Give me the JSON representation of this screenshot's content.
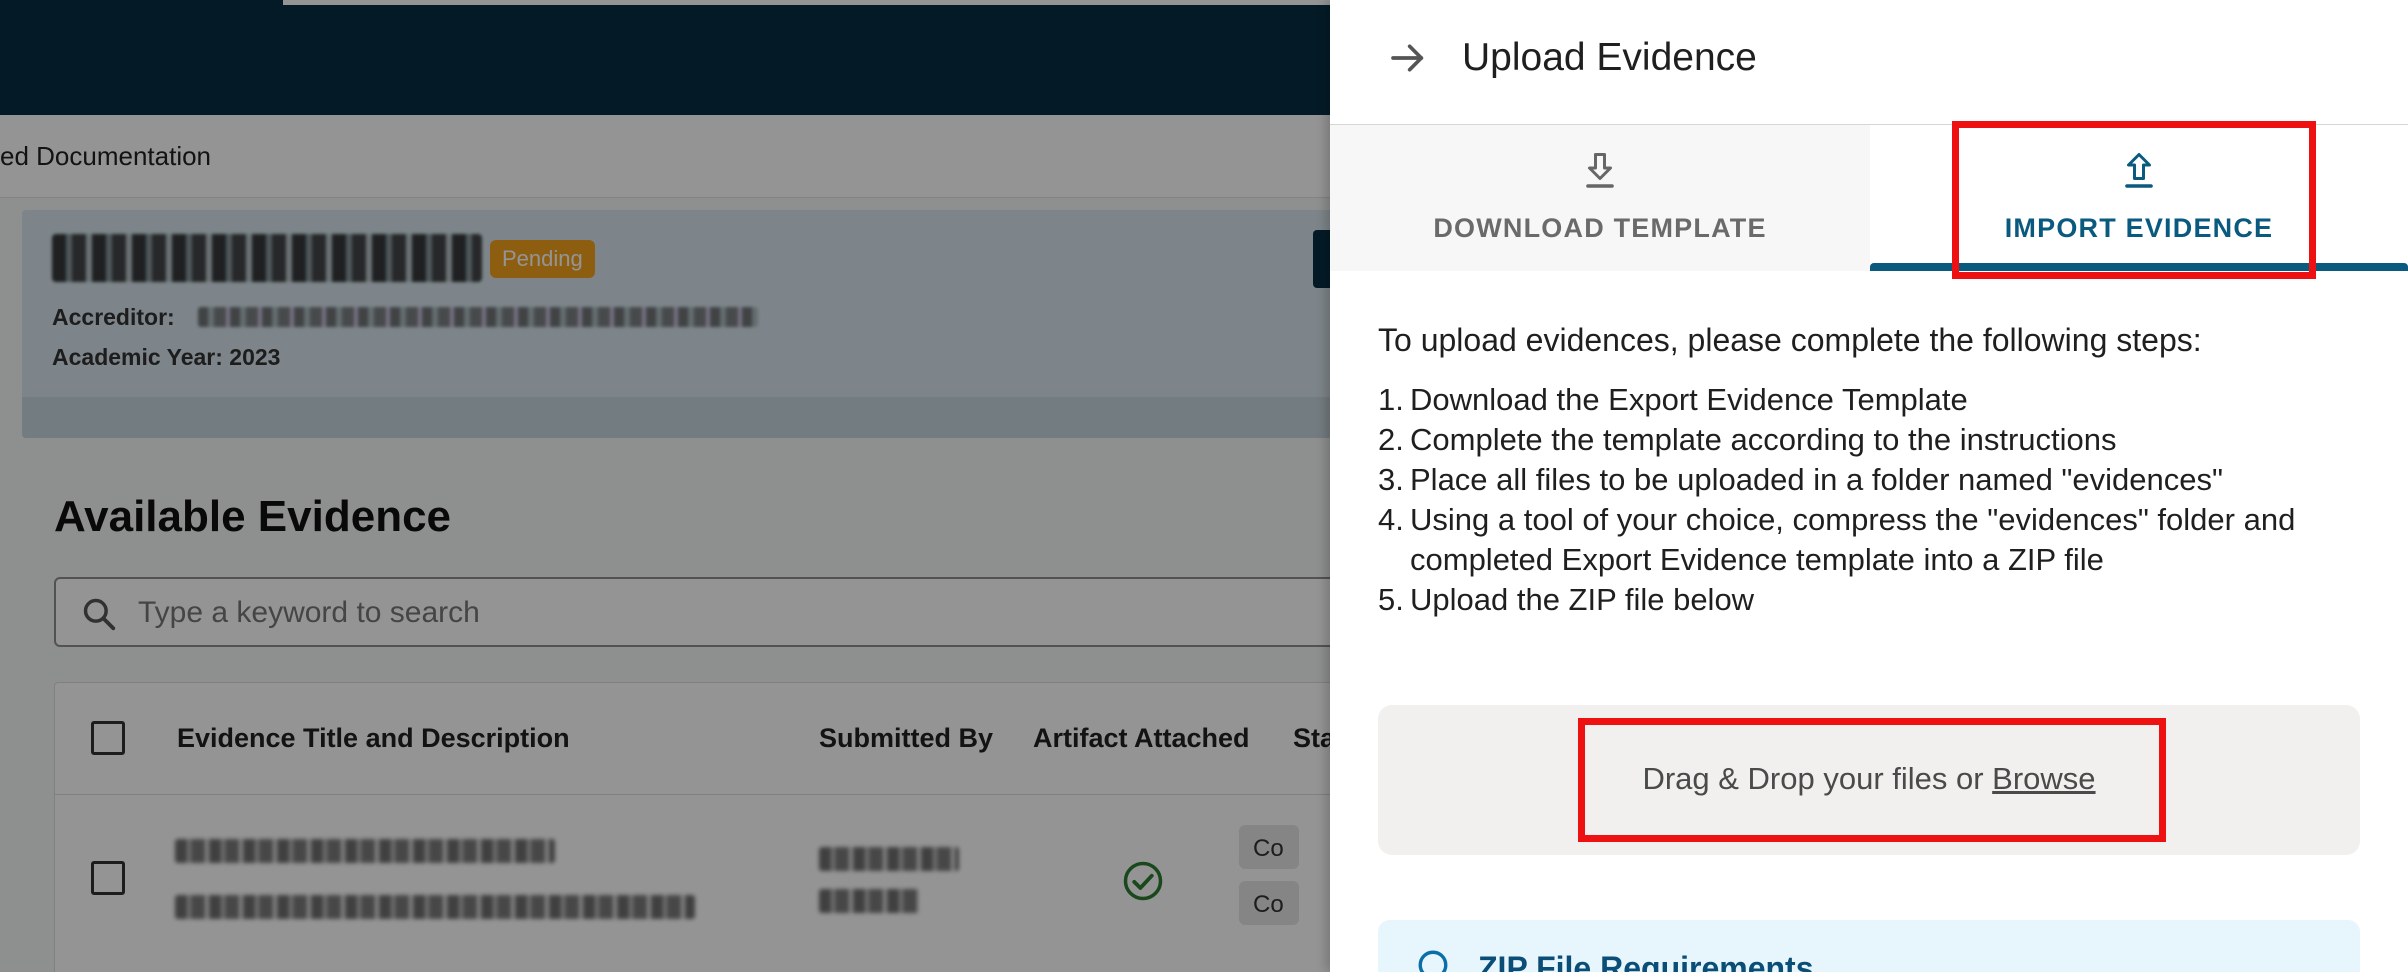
{
  "background": {
    "breadcrumb": "ed Documentation",
    "status_badge": "Pending",
    "accreditor_label": "Accreditor:",
    "academic_year": "Academic Year: 2023",
    "section_title": "Available Evidence",
    "search_placeholder": "Type a keyword to search",
    "columns": [
      "Evidence Title and Description",
      "Submitted By",
      "Artifact Attached",
      "Sta"
    ],
    "status_chip_1": "Co",
    "status_chip_2": "Co"
  },
  "drawer": {
    "title": "Upload Evidence",
    "tabs": {
      "download": "DOWNLOAD TEMPLATE",
      "import": "IMPORT EVIDENCE"
    },
    "intro": "To upload evidences, please complete the following steps:",
    "steps": [
      {
        "num": "1.",
        "text": "Download the Export Evidence Template"
      },
      {
        "num": "2.",
        "text": "Complete the template according to the instructions"
      },
      {
        "num": "3.",
        "text": "Place all files to be uploaded in a folder named \"evidences\""
      },
      {
        "num": "4.",
        "text": "Using a tool of your choice, compress the \"evidences\" folder and completed Export Evidence template into a ZIP file"
      },
      {
        "num": "5.",
        "text": "Upload the ZIP file below"
      }
    ],
    "dropzone": {
      "text": "Drag & Drop your files or ",
      "browse": "Browse"
    },
    "requirements_title": "ZIP File Requirements"
  },
  "colors": {
    "topbar": "#083044",
    "accent": "#0a5a80",
    "highlight": "#ee1111",
    "pending": "#f3a21c",
    "success": "#2e7d32"
  },
  "icons": [
    "arrow-right-icon",
    "download-icon",
    "upload-icon",
    "search-icon",
    "check-circle-icon",
    "info-icon"
  ]
}
